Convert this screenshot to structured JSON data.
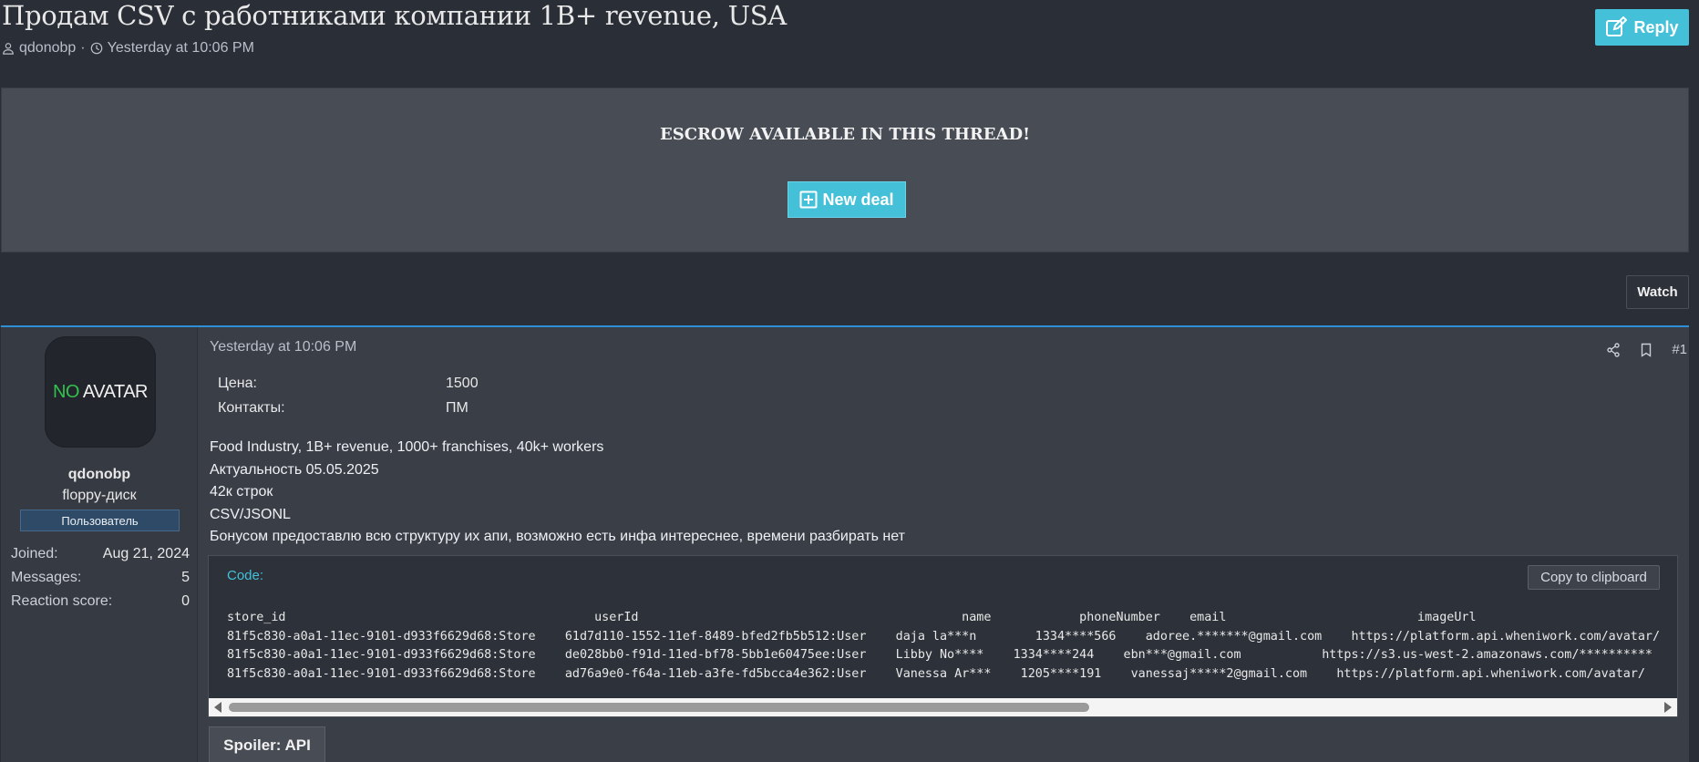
{
  "thread": {
    "title": "Продам CSV с работниками компании 1B+ revenue, USA",
    "author": "qdonobp",
    "separator": "·",
    "date": "Yesterday at 10:06 PM",
    "reply_label": "Reply"
  },
  "escrow": {
    "title": "ESCROW AVAILABLE IN THIS THREAD!",
    "new_deal_label": "New deal"
  },
  "watch_label": "Watch",
  "post": {
    "user": {
      "avatar_no": "NO",
      "avatar_text": " AVATAR",
      "username": "qdonobp",
      "title": "floppy-диск",
      "banner": "Пользователь",
      "stats": [
        {
          "label": "Joined:",
          "value": "Aug 21, 2024"
        },
        {
          "label": "Messages:",
          "value": "5"
        },
        {
          "label": "Reaction score:",
          "value": "0"
        }
      ]
    },
    "date": "Yesterday at 10:06 PM",
    "number": "#1",
    "fields": [
      {
        "label": "Цена:",
        "value": "1500"
      },
      {
        "label": "Контакты:",
        "value": "ПМ"
      }
    ],
    "body": [
      "Food Industry, 1B+ revenue, 1000+ franchises, 40k+ workers",
      "Актуальность 05.05.2025",
      "42к строк",
      "CSV/JSONL",
      "Бонусом предоставлю всю структуру их апи, возможно есть инфа интереснее, времени разбирать нет"
    ],
    "code": {
      "label": "Code:",
      "copy_label": "Copy to clipboard",
      "lines": [
        "store_id                                          userId                                            name            phoneNumber    email                          imageUrl",
        "81f5c830-a0a1-11ec-9101-d933f6629d68:Store    61d7d110-1552-11ef-8489-bfed2fb5b512:User    daja la***n        1334****566    adoree.*******@gmail.com    https://platform.api.wheniwork.com/avatar/",
        "81f5c830-a0a1-11ec-9101-d933f6629d68:Store    de028bb0-f91d-11ed-bf78-5bb1e60475ee:User    Libby No****    1334****244    ebn***@gmail.com           https://s3.us-west-2.amazonaws.com/**********",
        "81f5c830-a0a1-11ec-9101-d933f6629d68:Store    ad76a9e0-f64a-11eb-a3fe-fd5bcca4e362:User    Vanessa Ar***    1205****191    vanessaj*****2@gmail.com    https://platform.api.wheniwork.com/avatar/"
      ]
    },
    "spoiler_label": "Spoiler: API"
  }
}
